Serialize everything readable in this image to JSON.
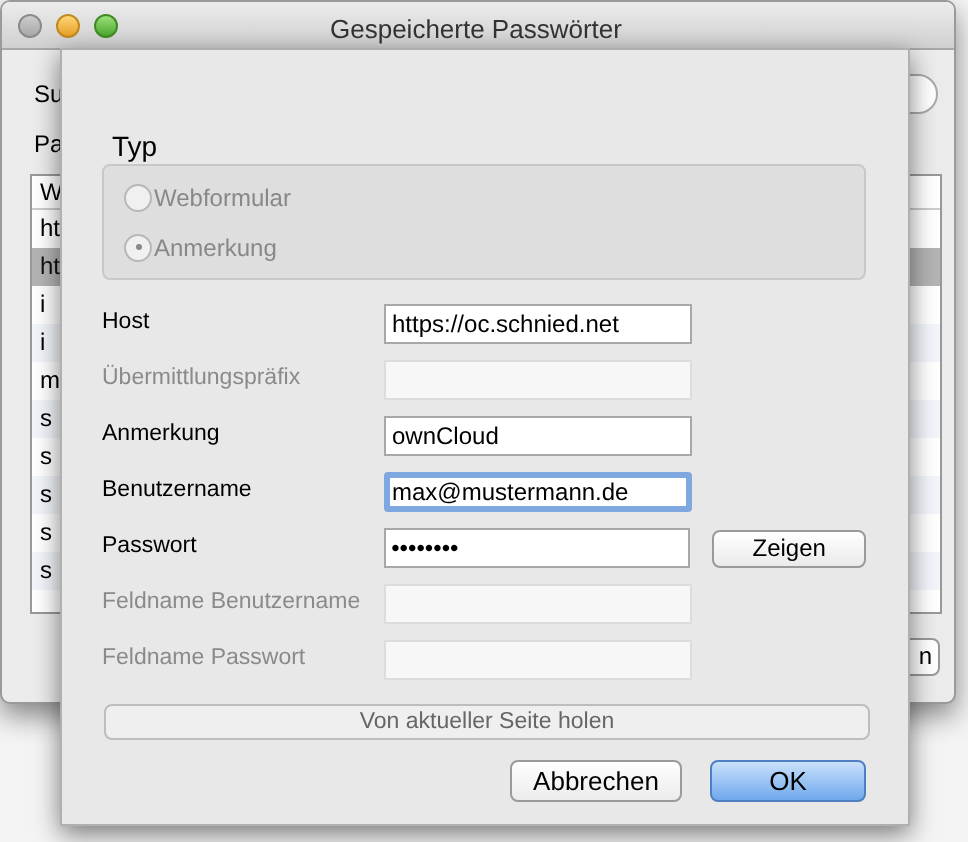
{
  "window": {
    "title": "Gespeicherte Passwörter"
  },
  "background": {
    "search_label": "Su",
    "passwords_label": "Pa",
    "table_header": "W",
    "rows": [
      {
        "text": "ht",
        "selected": false
      },
      {
        "text": "ht",
        "selected": true
      },
      {
        "text": "i",
        "selected": false
      },
      {
        "text": "i",
        "selected": false
      },
      {
        "text": "m",
        "selected": false
      },
      {
        "text": "s",
        "selected": false
      },
      {
        "text": "s",
        "selected": false
      },
      {
        "text": "s",
        "selected": false
      },
      {
        "text": "s",
        "selected": false
      },
      {
        "text": "s",
        "selected": false
      }
    ],
    "right_button": "n"
  },
  "sheet": {
    "type_title": "Typ",
    "radios": [
      {
        "label": "Webformular",
        "selected": false,
        "disabled": true
      },
      {
        "label": "Anmerkung",
        "selected": true,
        "disabled": true
      }
    ],
    "fields": [
      {
        "label": "Host",
        "value": "https://oc.schnied.net",
        "disabled": false,
        "focused": false
      },
      {
        "label": "Übermittlungspräfix",
        "disabled": true,
        "focused": false
      },
      {
        "label": "Anmerkung",
        "value": "ownCloud",
        "disabled": false,
        "focused": false
      },
      {
        "label": "Benutzername",
        "value": "max@mustermann.de",
        "disabled": false,
        "focused": true
      },
      {
        "label": "Passwort",
        "value": "••••••••",
        "disabled": false,
        "focused": false,
        "button": "Zeigen"
      },
      {
        "label": "Feldname Benutzername",
        "disabled": true,
        "focused": false
      },
      {
        "label": "Feldname Passwort",
        "disabled": true,
        "focused": false
      }
    ],
    "fetch_button": {
      "label": "Von aktueller Seite holen",
      "disabled": true
    },
    "cancel_button": "Abbrechen",
    "ok_button": "OK"
  }
}
